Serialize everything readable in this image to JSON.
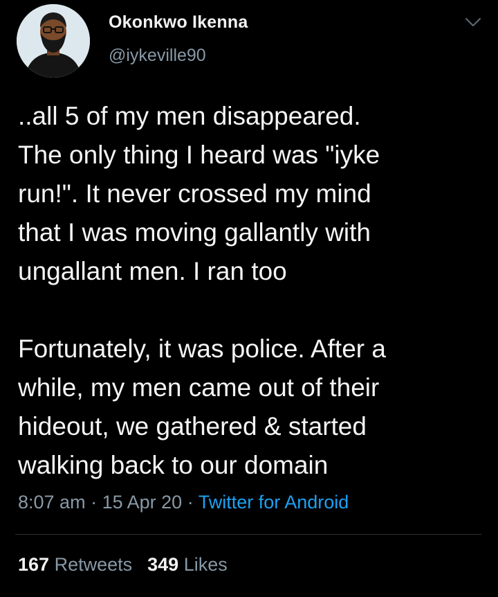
{
  "tweet": {
    "author": {
      "display_name": "Okonkwo Ikenna",
      "handle": "@iykeville90",
      "avatar_icon": "profile-avatar-illustration"
    },
    "menu_icon": "chevron-down-icon",
    "text": "..all 5 of my men disappeared.\nThe only thing I heard was \"iyke\nrun!\". It never crossed my mind\nthat I was moving gallantly with\nungallant men. I ran too\n\nFortunately, it was police. After a\nwhile, my men came out of their\nhideout, we gathered & started\nwalking back to our domain",
    "time": "8:07 am",
    "separator": "·",
    "date": "15 Apr 20",
    "source": "Twitter for Android",
    "retweets_count": "167",
    "retweets_label": "Retweets",
    "likes_count": "349",
    "likes_label": "Likes"
  },
  "colors": {
    "background": "#000000",
    "text": "#f5f5f5",
    "muted": "#8899a6",
    "link": "#1da1f2",
    "avatar_bg": "#dde8ee"
  }
}
